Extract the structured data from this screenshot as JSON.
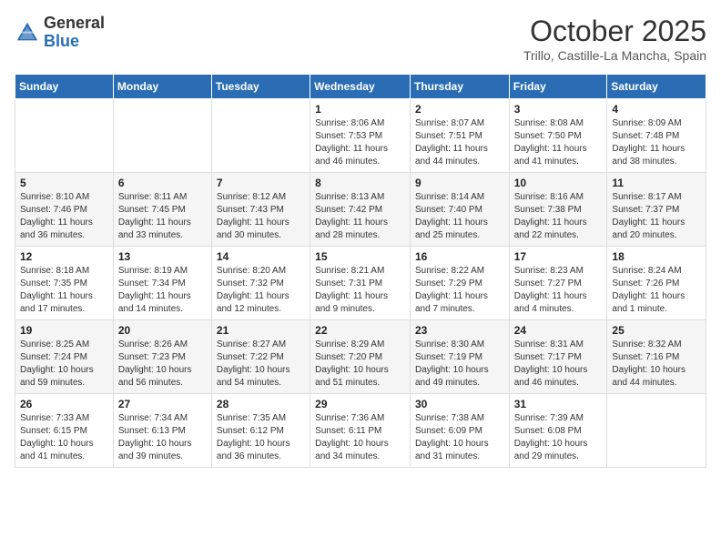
{
  "header": {
    "logo_general": "General",
    "logo_blue": "Blue",
    "month_title": "October 2025",
    "location": "Trillo, Castille-La Mancha, Spain"
  },
  "weekdays": [
    "Sunday",
    "Monday",
    "Tuesday",
    "Wednesday",
    "Thursday",
    "Friday",
    "Saturday"
  ],
  "weeks": [
    [
      {
        "day": "",
        "info": ""
      },
      {
        "day": "",
        "info": ""
      },
      {
        "day": "",
        "info": ""
      },
      {
        "day": "1",
        "info": "Sunrise: 8:06 AM\nSunset: 7:53 PM\nDaylight: 11 hours\nand 46 minutes."
      },
      {
        "day": "2",
        "info": "Sunrise: 8:07 AM\nSunset: 7:51 PM\nDaylight: 11 hours\nand 44 minutes."
      },
      {
        "day": "3",
        "info": "Sunrise: 8:08 AM\nSunset: 7:50 PM\nDaylight: 11 hours\nand 41 minutes."
      },
      {
        "day": "4",
        "info": "Sunrise: 8:09 AM\nSunset: 7:48 PM\nDaylight: 11 hours\nand 38 minutes."
      }
    ],
    [
      {
        "day": "5",
        "info": "Sunrise: 8:10 AM\nSunset: 7:46 PM\nDaylight: 11 hours\nand 36 minutes."
      },
      {
        "day": "6",
        "info": "Sunrise: 8:11 AM\nSunset: 7:45 PM\nDaylight: 11 hours\nand 33 minutes."
      },
      {
        "day": "7",
        "info": "Sunrise: 8:12 AM\nSunset: 7:43 PM\nDaylight: 11 hours\nand 30 minutes."
      },
      {
        "day": "8",
        "info": "Sunrise: 8:13 AM\nSunset: 7:42 PM\nDaylight: 11 hours\nand 28 minutes."
      },
      {
        "day": "9",
        "info": "Sunrise: 8:14 AM\nSunset: 7:40 PM\nDaylight: 11 hours\nand 25 minutes."
      },
      {
        "day": "10",
        "info": "Sunrise: 8:16 AM\nSunset: 7:38 PM\nDaylight: 11 hours\nand 22 minutes."
      },
      {
        "day": "11",
        "info": "Sunrise: 8:17 AM\nSunset: 7:37 PM\nDaylight: 11 hours\nand 20 minutes."
      }
    ],
    [
      {
        "day": "12",
        "info": "Sunrise: 8:18 AM\nSunset: 7:35 PM\nDaylight: 11 hours\nand 17 minutes."
      },
      {
        "day": "13",
        "info": "Sunrise: 8:19 AM\nSunset: 7:34 PM\nDaylight: 11 hours\nand 14 minutes."
      },
      {
        "day": "14",
        "info": "Sunrise: 8:20 AM\nSunset: 7:32 PM\nDaylight: 11 hours\nand 12 minutes."
      },
      {
        "day": "15",
        "info": "Sunrise: 8:21 AM\nSunset: 7:31 PM\nDaylight: 11 hours\nand 9 minutes."
      },
      {
        "day": "16",
        "info": "Sunrise: 8:22 AM\nSunset: 7:29 PM\nDaylight: 11 hours\nand 7 minutes."
      },
      {
        "day": "17",
        "info": "Sunrise: 8:23 AM\nSunset: 7:27 PM\nDaylight: 11 hours\nand 4 minutes."
      },
      {
        "day": "18",
        "info": "Sunrise: 8:24 AM\nSunset: 7:26 PM\nDaylight: 11 hours\nand 1 minute."
      }
    ],
    [
      {
        "day": "19",
        "info": "Sunrise: 8:25 AM\nSunset: 7:24 PM\nDaylight: 10 hours\nand 59 minutes."
      },
      {
        "day": "20",
        "info": "Sunrise: 8:26 AM\nSunset: 7:23 PM\nDaylight: 10 hours\nand 56 minutes."
      },
      {
        "day": "21",
        "info": "Sunrise: 8:27 AM\nSunset: 7:22 PM\nDaylight: 10 hours\nand 54 minutes."
      },
      {
        "day": "22",
        "info": "Sunrise: 8:29 AM\nSunset: 7:20 PM\nDaylight: 10 hours\nand 51 minutes."
      },
      {
        "day": "23",
        "info": "Sunrise: 8:30 AM\nSunset: 7:19 PM\nDaylight: 10 hours\nand 49 minutes."
      },
      {
        "day": "24",
        "info": "Sunrise: 8:31 AM\nSunset: 7:17 PM\nDaylight: 10 hours\nand 46 minutes."
      },
      {
        "day": "25",
        "info": "Sunrise: 8:32 AM\nSunset: 7:16 PM\nDaylight: 10 hours\nand 44 minutes."
      }
    ],
    [
      {
        "day": "26",
        "info": "Sunrise: 7:33 AM\nSunset: 6:15 PM\nDaylight: 10 hours\nand 41 minutes."
      },
      {
        "day": "27",
        "info": "Sunrise: 7:34 AM\nSunset: 6:13 PM\nDaylight: 10 hours\nand 39 minutes."
      },
      {
        "day": "28",
        "info": "Sunrise: 7:35 AM\nSunset: 6:12 PM\nDaylight: 10 hours\nand 36 minutes."
      },
      {
        "day": "29",
        "info": "Sunrise: 7:36 AM\nSunset: 6:11 PM\nDaylight: 10 hours\nand 34 minutes."
      },
      {
        "day": "30",
        "info": "Sunrise: 7:38 AM\nSunset: 6:09 PM\nDaylight: 10 hours\nand 31 minutes."
      },
      {
        "day": "31",
        "info": "Sunrise: 7:39 AM\nSunset: 6:08 PM\nDaylight: 10 hours\nand 29 minutes."
      },
      {
        "day": "",
        "info": ""
      }
    ]
  ]
}
